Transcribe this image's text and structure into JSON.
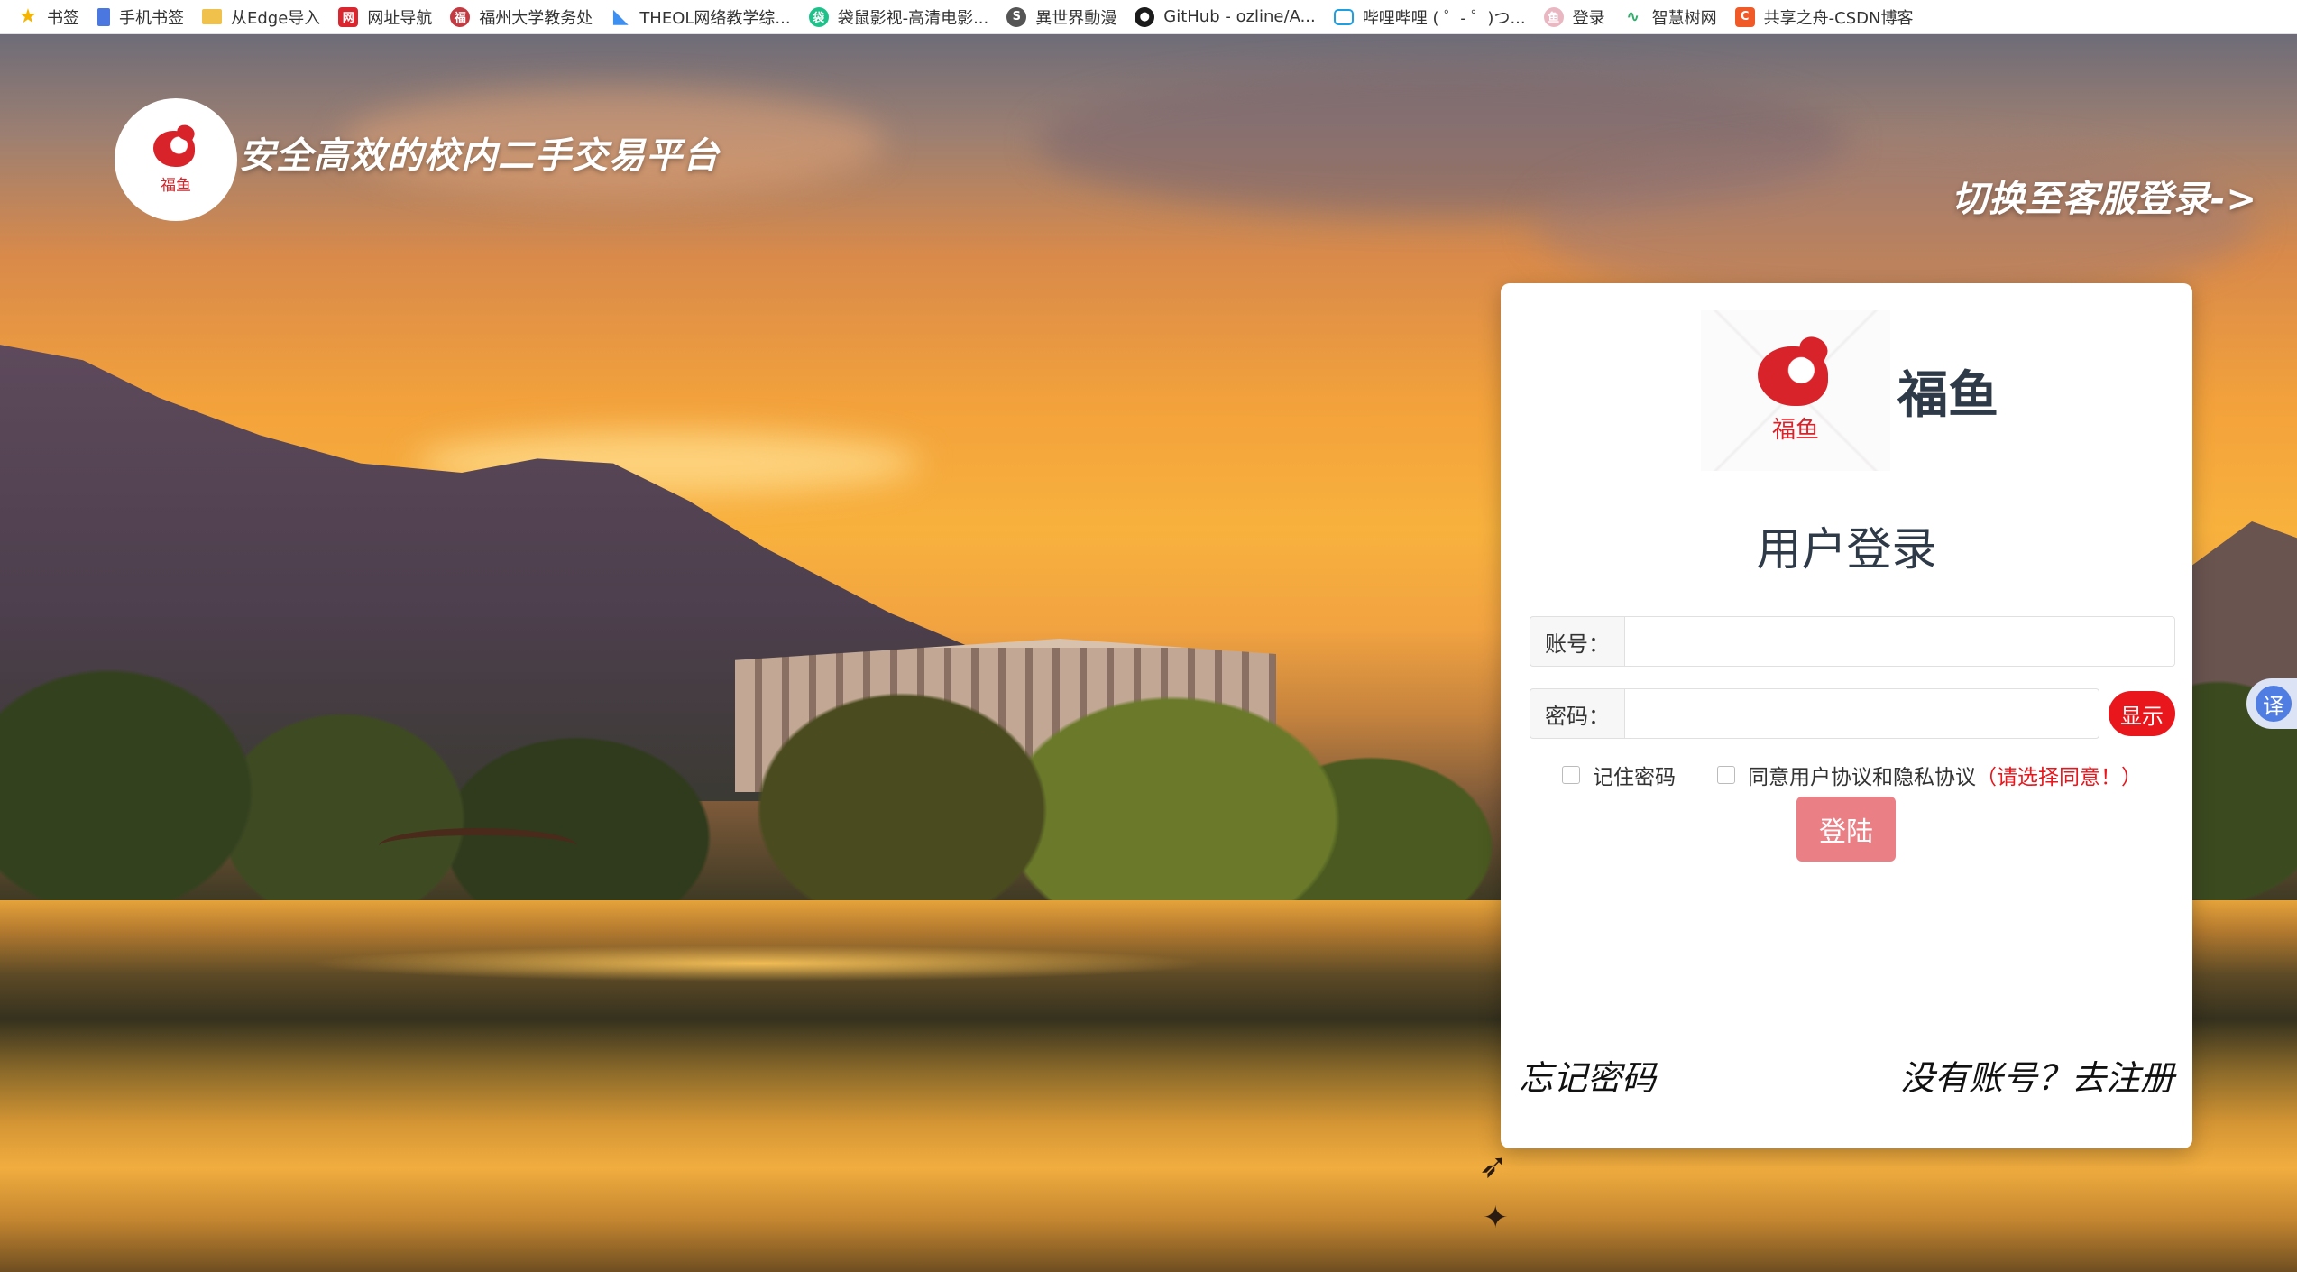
{
  "bookmarks": [
    {
      "label": "书签",
      "icon": "star-icon"
    },
    {
      "label": "手机书签",
      "icon": "phone-icon"
    },
    {
      "label": "从Edge导入",
      "icon": "folder-icon"
    },
    {
      "label": "网址导航",
      "icon": "nav-site-icon"
    },
    {
      "label": "福州大学教务处",
      "icon": "university-icon"
    },
    {
      "label": "THEOL网络教学综...",
      "icon": "theol-icon"
    },
    {
      "label": "袋鼠影视-高清电影...",
      "icon": "kangaroo-icon"
    },
    {
      "label": "異世界動漫",
      "icon": "anime-icon"
    },
    {
      "label": "GitHub - ozline/A...",
      "icon": "github-icon"
    },
    {
      "label": "哔哩哔哩 ( ゜- ゜)つ...",
      "icon": "bilibili-icon"
    },
    {
      "label": "登录",
      "icon": "login-site-icon"
    },
    {
      "label": "智慧树网",
      "icon": "zhihuishu-icon"
    },
    {
      "label": "共享之舟-CSDN博客",
      "icon": "csdn-icon"
    }
  ],
  "header": {
    "logo_text": "福鱼",
    "slogan": "安全高效的校内二手交易平台",
    "switch_link": "切换至客服登录->"
  },
  "login": {
    "brand_logo_text": "福鱼",
    "brand_name": "福鱼",
    "title": "用户登录",
    "account_label": "账号：",
    "account_value": "",
    "password_label": "密码：",
    "password_value": "",
    "show_button": "显示",
    "remember_label": "记住密码",
    "agree_label": "同意用户协议和隐私协议",
    "agree_warning": "（请选择同意！）",
    "login_button": "登陆",
    "forgot_link": "忘记密码",
    "register_link": "没有账号？去注册"
  },
  "translate": {
    "label": "译"
  },
  "colors": {
    "accent_red": "#e9161c",
    "login_button": "#eb7f86",
    "title_text": "#2e3a48"
  }
}
